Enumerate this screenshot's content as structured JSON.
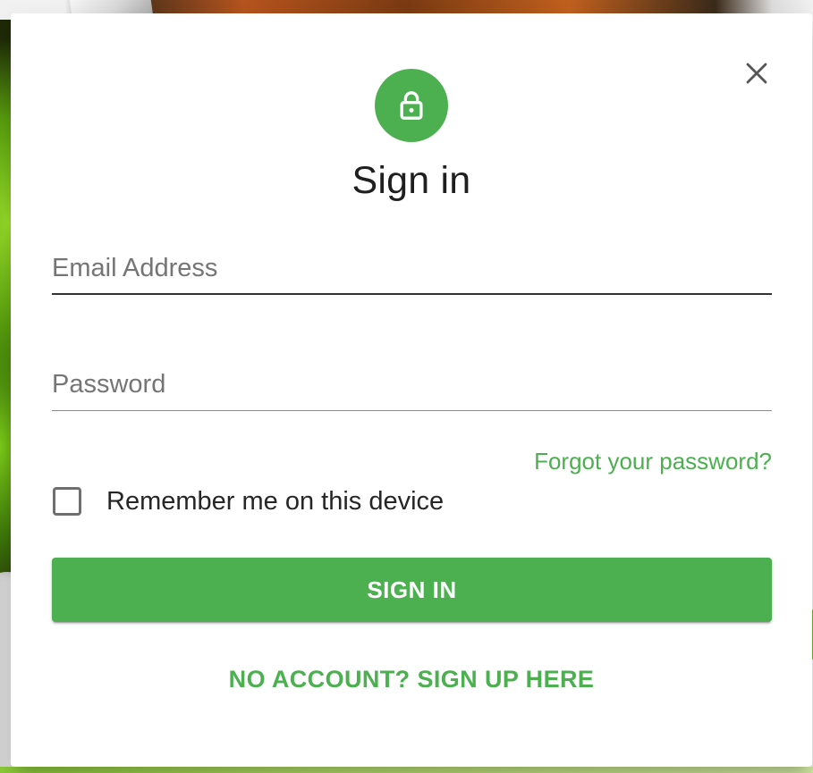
{
  "dialog": {
    "title": "Sign in",
    "close_icon": "close-icon",
    "avatar_icon": "lock-icon",
    "accent_color": "#4caf50"
  },
  "form": {
    "email": {
      "value": "",
      "placeholder": "Email Address"
    },
    "password": {
      "value": "",
      "placeholder": "Password"
    },
    "forgot_password_label": "Forgot your password?",
    "remember_me": {
      "label": "Remember me on this device",
      "checked": false
    },
    "submit_label": "SIGN IN",
    "signup_label": "NO ACCOUNT? SIGN UP HERE"
  }
}
